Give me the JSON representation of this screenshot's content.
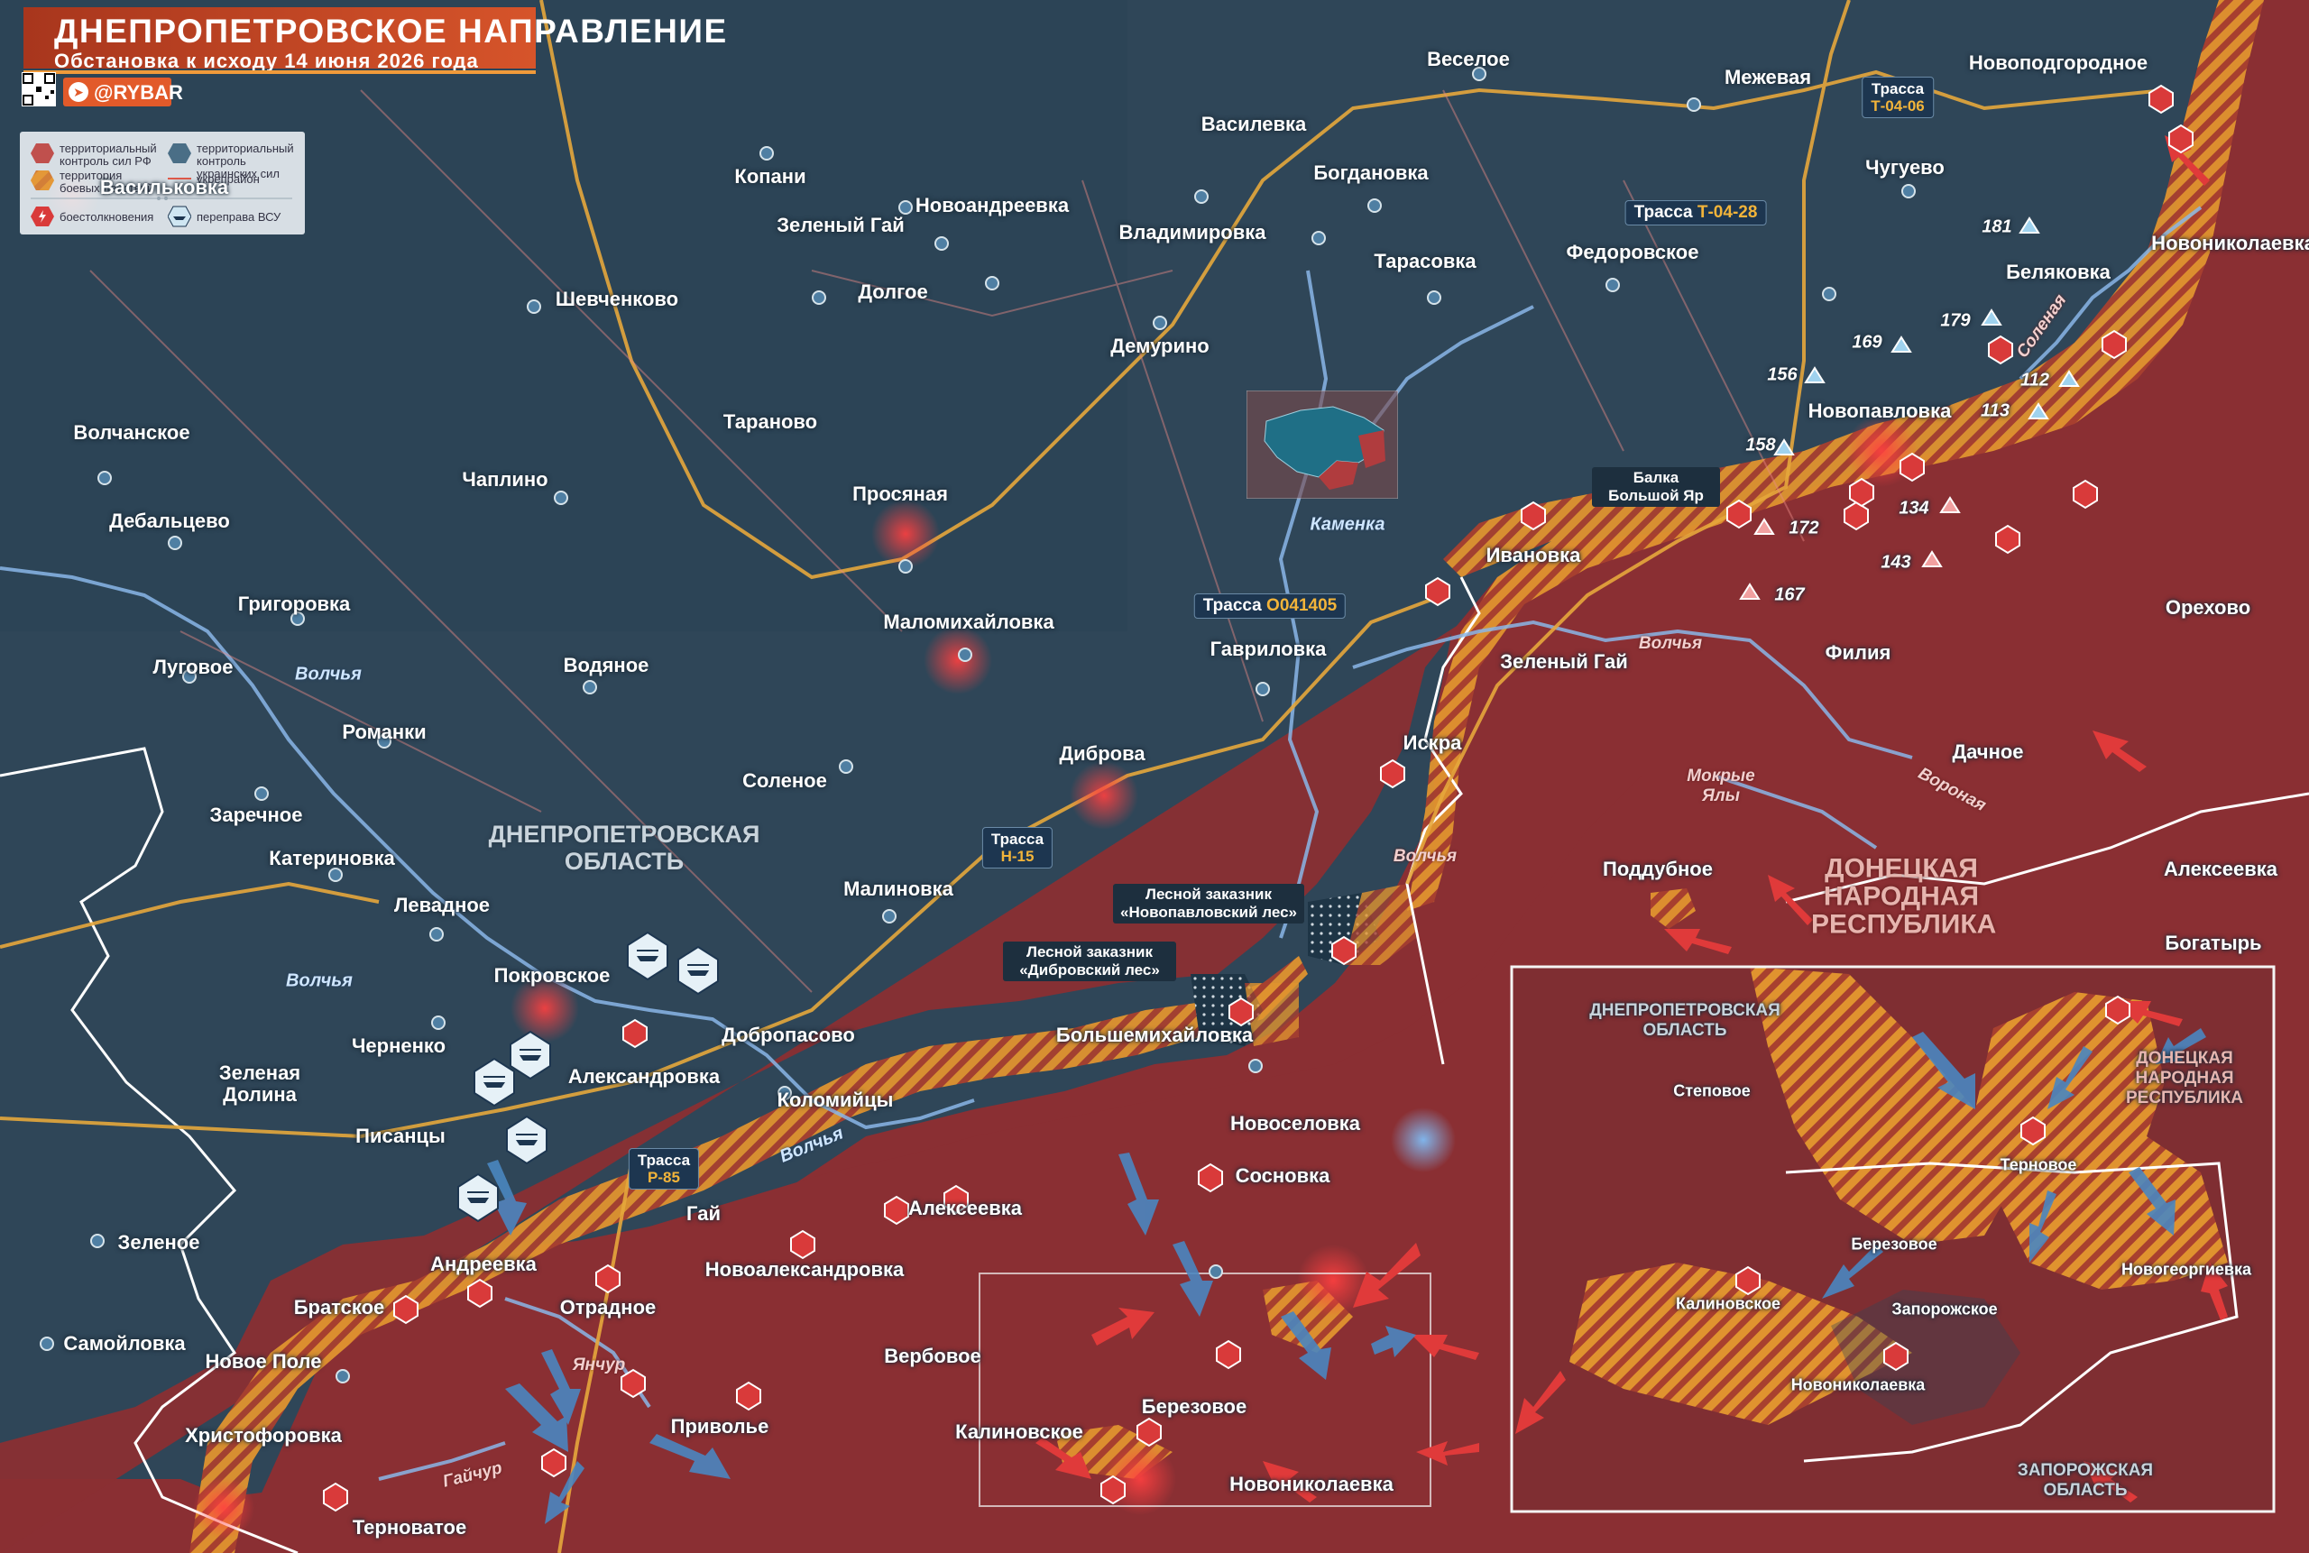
{
  "header": {
    "title": "ДНЕПРОПЕТРОВСКОЕ НАПРАВЛЕНИЕ",
    "subtitle": "Обстановка к исходу 14 июня 2026 года",
    "brand": "@RYBAR"
  },
  "legend": {
    "items": [
      {
        "label": "территориальный контроль сил РФ",
        "icon": "red-hexagon-icon",
        "color": "#c0504d"
      },
      {
        "label": "территориальный контроль украинских сил",
        "icon": "blue-hexagon-icon",
        "color": "#4a6e86"
      },
      {
        "label": "территория боевых действий",
        "icon": "hatched-hexagon-icon",
        "color": "#e69a3c"
      },
      {
        "label": "укрепрайон",
        "icon": "red-line-icon",
        "color": "#e05a4a"
      },
      {
        "label": "боестолкновения",
        "icon": "clash-icon",
        "color": "#d93a3a"
      },
      {
        "label": "переправа ВСУ",
        "icon": "ferry-icon",
        "color": "#cfe6f2"
      }
    ]
  },
  "colors": {
    "ua_territory": "#2f4658",
    "ru_territory": "#8a2f33",
    "combat_zone": "#e69a3c",
    "roads": "#e6a73c",
    "rivers": "#8ab6e8",
    "boundary": "#ffffff",
    "fortification": "#e05a4a"
  },
  "regions": {
    "dnipro": "ДНЕПРОПЕТРОВСКАЯ ОБЛАСТЬ",
    "dpr": "ДОНЕЦКАЯ НАРОДНАЯ РЕСПУБЛИКА"
  },
  "settlements_ua": [
    "Васильковка",
    "Волчанское",
    "Дебальцево",
    "Григоровка",
    "Луговое",
    "Романки",
    "Заречное",
    "Катериновка",
    "Левадное",
    "Зеленая Долина",
    "Черненко",
    "Писанцы",
    "Зеленое",
    "Самойловка",
    "Новое Поле",
    "Христофоровка",
    "Шевченково",
    "Чаплино",
    "Водяное",
    "Копани",
    "Зеленый Гай",
    "Новоандреевка",
    "Долгое",
    "Тараново",
    "Соленое",
    "Малиновка",
    "Коломийцы",
    "Добропасово",
    "Александровка",
    "Покровское",
    "Маломихайловка",
    "Василевка",
    "Владимировка",
    "Демурино",
    "Богдановка",
    "Тарасовка",
    "Веселое",
    "Межевая",
    "Федоровское",
    "Чугуево",
    "Новоподгородное",
    "Беляковка",
    "Гавриловка",
    "Большемихайловка"
  ],
  "settlements_ru": [
    "Андреевка",
    "Братское",
    "Терноватое",
    "Отрадное",
    "Гай",
    "Новоалександровка",
    "Приволье",
    "Вербовое",
    "Калиновское",
    "Березовое",
    "Новониколаевка",
    "Сосновка",
    "Алексеевка",
    "Новоселовка",
    "Искра",
    "Зеленый Гай",
    "Филия",
    "Поддубное",
    "Дачное",
    "Орехово",
    "Алексеевка",
    "Богатырь",
    "Новониколаевка",
    "Ивановка",
    "Новопавловка",
    "Просяная",
    "Диброва"
  ],
  "labels": {
    "river_volchya": "Волчья",
    "river_kamenka": "Каменка",
    "river_yanchur": "Янчур",
    "river_gaichur": "Гайчур",
    "river_mokrye_yaly": "Мокрые Ялы",
    "river_solenaya": "Соленая",
    "river_voronaya": "Вороная",
    "forest_novopavlovsky": "Лесной заказник «Новопавловский лес»",
    "forest_dibrovsky": "Лесной заказник «Дибровский лес»",
    "balka": "Балка Большой Яр"
  },
  "roads": {
    "t0406_prefix": "Трасса",
    "t0406_code": "Т-04-06",
    "t0428_prefix": "Трасса",
    "t0428_code": "Т-04-28",
    "o041405_prefix": "Трасса",
    "o041405_code": "О041405",
    "h15_prefix": "Трасса",
    "h15_code": "Н-15",
    "p85_prefix": "Трасса",
    "p85_code": "Р-85"
  },
  "heights": [
    "181",
    "179",
    "169",
    "156",
    "112",
    "113",
    "158",
    "172",
    "134",
    "143",
    "167"
  ],
  "inset": {
    "region_dnipro": "ДНЕПРОПЕТРОВСКАЯ ОБЛАСТЬ",
    "region_dpr": "ДОНЕЦКАЯ НАРОДНАЯ РЕСПУБЛИКА",
    "region_zap": "ЗАПОРОЖСКАЯ ОБЛАСТЬ",
    "places": [
      "Степовое",
      "Терновое",
      "Березовое",
      "Калиновское",
      "Запорожское",
      "Новогеоргиевка",
      "Новониколаевка"
    ]
  }
}
